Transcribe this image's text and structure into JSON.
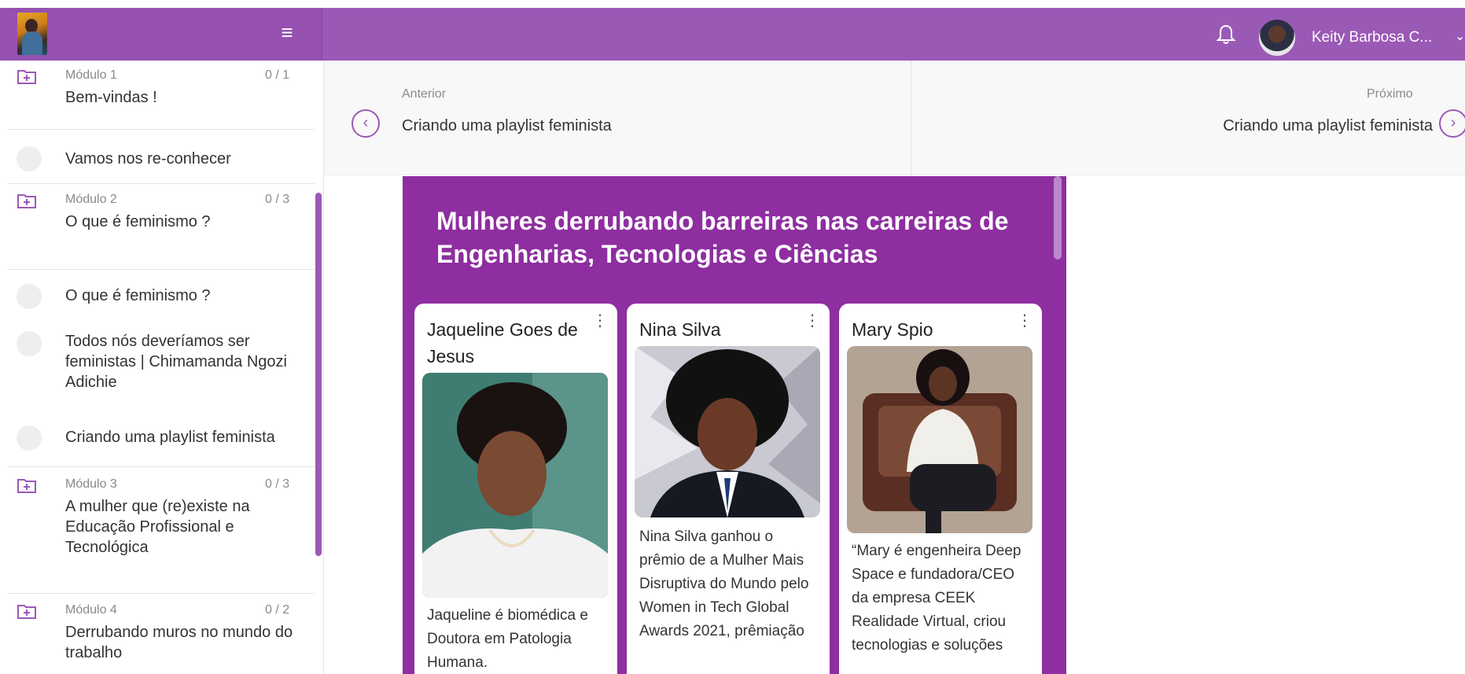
{
  "header": {
    "menu_icon": "hamburger-icon",
    "user_name": "Keity Barbosa C...",
    "colors": {
      "bar": "#9b59b6",
      "accent": "#9b59b6"
    }
  },
  "sidebar": {
    "modules": [
      {
        "num": "Módulo 1",
        "count": "0 / 1",
        "title": "Bem-vindas !"
      },
      {
        "num": "Módulo 2",
        "count": "0 / 3",
        "title": "O que é feminismo ?"
      },
      {
        "num": "Módulo 3",
        "count": "0 / 3",
        "title": "A mulher que (re)existe na Educação Profissional e Tecnológica"
      },
      {
        "num": "Módulo 4",
        "count": "0 / 2",
        "title": "Derrubando muros no mundo do trabalho"
      }
    ],
    "lessons": [
      "Vamos nos re-conhecer",
      "O que é feminismo ?",
      "Todos nós deveríamos ser feministas | Chimamanda Ngozi Adichie",
      "Criando uma playlist feminista"
    ]
  },
  "nav": {
    "prev_label": "Anterior",
    "prev_title": "Criando uma playlist feminista",
    "next_label": "Próximo",
    "next_title": "Criando uma playlist feminista"
  },
  "content": {
    "headline": "Mulheres derrubando barreiras nas carreiras de Engenharias, Tecnologias e Ciências",
    "bg_color": "#8e2ea0",
    "cards": [
      {
        "name": "Jaqueline Goes de Jesus",
        "desc": "Jaqueline é biomédica e Doutora em Patologia Humana."
      },
      {
        "name": "Nina Silva",
        "desc": "Nina Silva ganhou o prêmio de a Mulher Mais Disruptiva do Mundo pelo Women in Tech Global Awards 2021, prêmiação"
      },
      {
        "name": "Mary Spio",
        "desc": "“Mary é engenheira Deep Space e fundadora/CEO da empresa CEEK Realidade Virtual, criou tecnologias e soluções"
      }
    ]
  }
}
